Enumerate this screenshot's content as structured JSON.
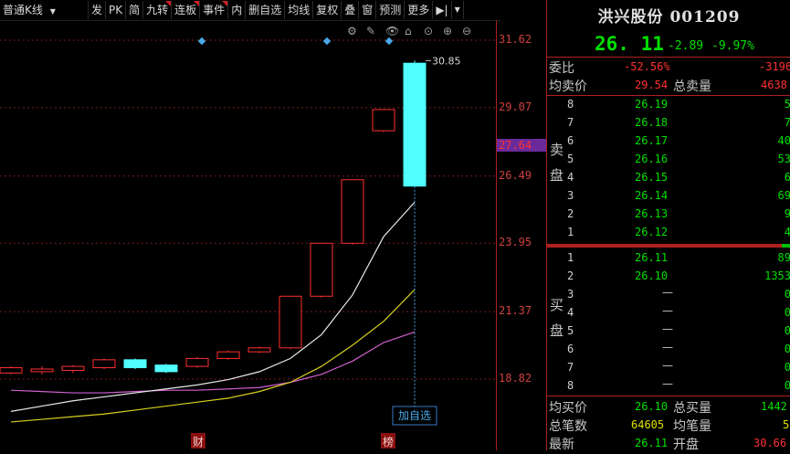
{
  "toolbar": {
    "period": "普通K线",
    "buttons": [
      "发",
      "PK",
      "简",
      "九转",
      "连板",
      "事件",
      "内",
      "删自选",
      "均线",
      "复权",
      "叠",
      "窗",
      "预测",
      "更多"
    ],
    "flagged": [
      3,
      4,
      5
    ]
  },
  "axis": {
    "ticks": [
      "31.62",
      "29.07",
      "26.49",
      "23.95",
      "21.37",
      "18.82"
    ],
    "current_price": "27.64"
  },
  "chart": {
    "peak_label": "30.85",
    "add_watch_button": "加自选",
    "bottom_markers": [
      "财",
      "榜"
    ],
    "candles": [
      {
        "open": 19.05,
        "close": 19.25,
        "high": 19.3,
        "low": 19.0
      },
      {
        "open": 19.1,
        "close": 19.2,
        "high": 19.3,
        "low": 19.0
      },
      {
        "open": 19.15,
        "close": 19.3,
        "high": 19.35,
        "low": 19.05
      },
      {
        "open": 19.25,
        "close": 19.55,
        "high": 19.6,
        "low": 19.2
      },
      {
        "open": 19.55,
        "close": 19.25,
        "high": 19.6,
        "low": 19.2
      },
      {
        "open": 19.35,
        "close": 19.1,
        "high": 19.4,
        "low": 19.05
      },
      {
        "open": 19.3,
        "close": 19.6,
        "high": 19.65,
        "low": 19.25
      },
      {
        "open": 19.6,
        "close": 19.85,
        "high": 19.9,
        "low": 19.55
      },
      {
        "open": 19.85,
        "close": 20.0,
        "high": 20.05,
        "low": 19.8
      },
      {
        "open": 20.0,
        "close": 21.95,
        "high": 21.95,
        "low": 19.95
      },
      {
        "open": 21.95,
        "close": 23.95,
        "high": 23.95,
        "low": 21.9
      },
      {
        "open": 23.95,
        "close": 26.35,
        "high": 26.35,
        "low": 23.9
      },
      {
        "open": 28.2,
        "close": 29.0,
        "high": 29.0,
        "low": 28.15
      },
      {
        "open": 30.75,
        "close": 26.11,
        "high": 30.85,
        "low": 26.11
      }
    ],
    "ma_white": [
      17.6,
      17.8,
      18.0,
      18.15,
      18.3,
      18.45,
      18.6,
      18.8,
      19.1,
      19.6,
      20.5,
      22.0,
      24.2,
      25.5
    ],
    "ma_yellow": [
      17.2,
      17.3,
      17.4,
      17.5,
      17.65,
      17.8,
      17.95,
      18.1,
      18.35,
      18.7,
      19.3,
      20.1,
      21.0,
      22.2
    ],
    "ma_pink": [
      18.4,
      18.35,
      18.3,
      18.3,
      18.35,
      18.4,
      18.4,
      18.45,
      18.5,
      18.7,
      19.0,
      19.5,
      20.2,
      20.6
    ]
  },
  "quote": {
    "title": "洪兴股份 001209",
    "price": "26. 11",
    "change": "-2.89",
    "change_pct": "-9.97%",
    "weibi_label": "委比",
    "weibi_value": "-52.56%",
    "weicha_value": "-3196",
    "avg_sell_label": "均卖价",
    "avg_sell_value": "29.54",
    "total_sell_label": "总卖量",
    "total_sell_value": "4638",
    "sell_side_label": [
      "卖",
      "盘"
    ],
    "sell_levels": [
      {
        "lvl": "8",
        "px": "26.19",
        "vol": "5"
      },
      {
        "lvl": "7",
        "px": "26.18",
        "vol": "7"
      },
      {
        "lvl": "6",
        "px": "26.17",
        "vol": "40"
      },
      {
        "lvl": "5",
        "px": "26.16",
        "vol": "53"
      },
      {
        "lvl": "4",
        "px": "26.15",
        "vol": "6"
      },
      {
        "lvl": "3",
        "px": "26.14",
        "vol": "69"
      },
      {
        "lvl": "2",
        "px": "26.13",
        "vol": "9"
      },
      {
        "lvl": "1",
        "px": "26.12",
        "vol": "4"
      }
    ],
    "buy_side_label": [
      "买",
      "盘"
    ],
    "buy_levels": [
      {
        "lvl": "1",
        "px": "26.11",
        "vol": "89"
      },
      {
        "lvl": "2",
        "px": "26.10",
        "vol": "1353"
      },
      {
        "lvl": "3",
        "px": "—",
        "vol": "0"
      },
      {
        "lvl": "4",
        "px": "—",
        "vol": "0"
      },
      {
        "lvl": "5",
        "px": "—",
        "vol": "0"
      },
      {
        "lvl": "6",
        "px": "—",
        "vol": "0"
      },
      {
        "lvl": "7",
        "px": "—",
        "vol": "0"
      },
      {
        "lvl": "8",
        "px": "—",
        "vol": "0"
      }
    ],
    "avg_buy_label": "均买价",
    "avg_buy_value": "26.10",
    "total_buy_label": "总买量",
    "total_buy_value": "1442",
    "total_trades_label": "总笔数",
    "total_trades_value": "64605",
    "avg_trade_label": "均笔量",
    "avg_trade_value": "5",
    "latest_label": "最新",
    "latest_value": "26.11",
    "open_label": "开盘",
    "open_value": "30.66"
  }
}
